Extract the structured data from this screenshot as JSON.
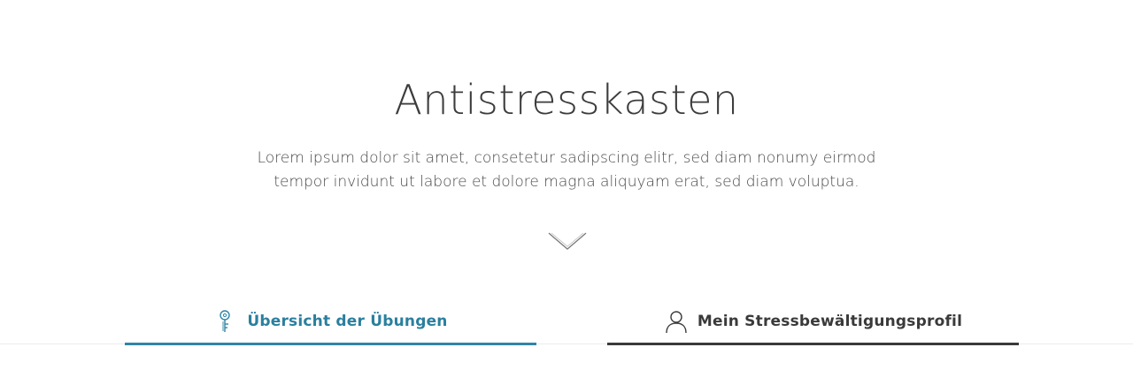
{
  "hero": {
    "title": "Antistresskasten",
    "lead_line1": "Lorem ipsum dolor sit amet, consetetur sadipscing elitr, sed diam nonumy eirmod",
    "lead_line2": "tempor invidunt ut labore et dolore magna aliquyam erat, sed diam voluptua.",
    "scroll_icon": "chevron-down-icon"
  },
  "tabs": [
    {
      "label": "Übersicht der Übungen",
      "icon": "key-icon",
      "active": true,
      "color": "#2e86a6"
    },
    {
      "label": "Mein Stressbewältigungsprofil",
      "icon": "user-icon",
      "active": false,
      "color": "#3a3a3a"
    }
  ]
}
